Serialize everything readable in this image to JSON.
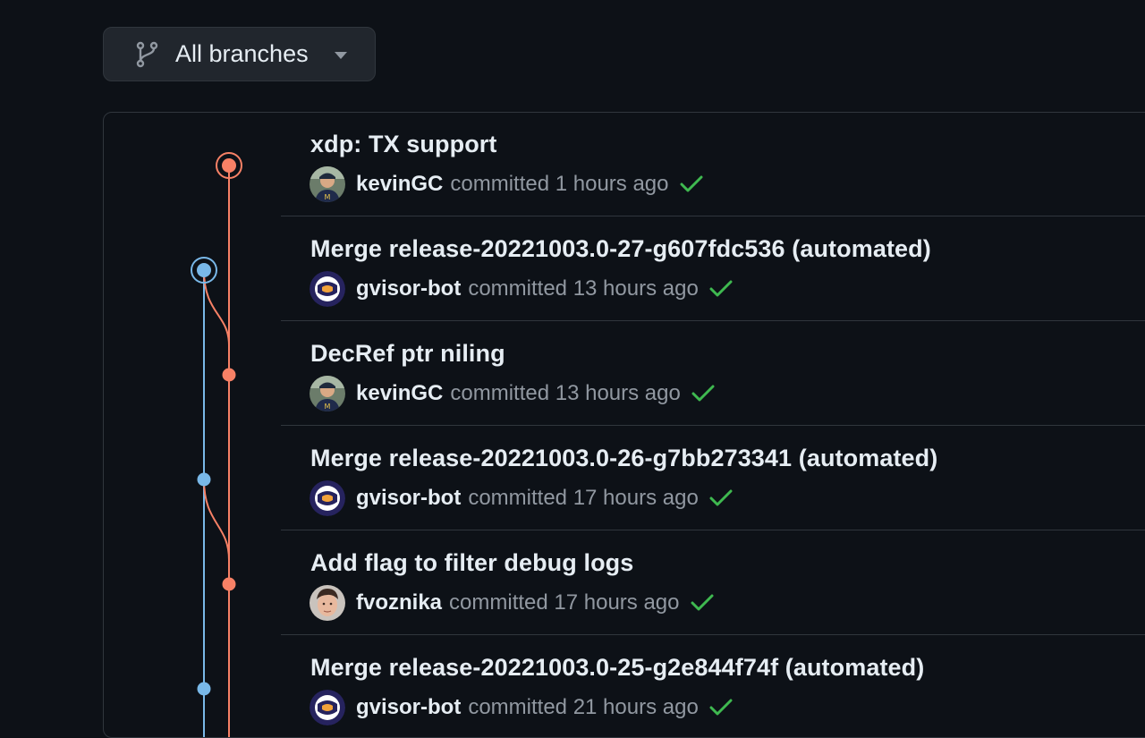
{
  "branch_selector": {
    "label": "All branches",
    "icon": "git-branch-icon"
  },
  "colors": {
    "background": "#0d1117",
    "border": "#30363d",
    "branch_main": "#f78166",
    "branch_release": "#79b8e8",
    "success": "#3fb950",
    "muted_text": "#9198a1"
  },
  "commits": [
    {
      "title": "xdp: TX support",
      "author": "kevinGC",
      "committed": "committed 1 hours ago",
      "avatar": "kevin-avatar",
      "status": "success-check-icon"
    },
    {
      "title": "Merge release-20221003.0-27-g607fdc536 (automated)",
      "author": "gvisor-bot",
      "committed": "committed 13 hours ago",
      "avatar": "gvisor-bot-avatar",
      "status": "success-check-icon"
    },
    {
      "title": "DecRef ptr niling",
      "author": "kevinGC",
      "committed": "committed 13 hours ago",
      "avatar": "kevin-avatar",
      "status": "success-check-icon"
    },
    {
      "title": "Merge release-20221003.0-26-g7bb273341 (automated)",
      "author": "gvisor-bot",
      "committed": "committed 17 hours ago",
      "avatar": "gvisor-bot-avatar",
      "status": "success-check-icon"
    },
    {
      "title": "Add flag to filter debug logs",
      "author": "fvoznika",
      "committed": "committed 17 hours ago",
      "avatar": "fvoznika-avatar",
      "status": "success-check-icon"
    },
    {
      "title": "Merge release-20221003.0-25-g2e844f74f (automated)",
      "author": "gvisor-bot",
      "committed": "committed 21 hours ago",
      "avatar": "gvisor-bot-avatar",
      "status": "success-check-icon"
    }
  ]
}
